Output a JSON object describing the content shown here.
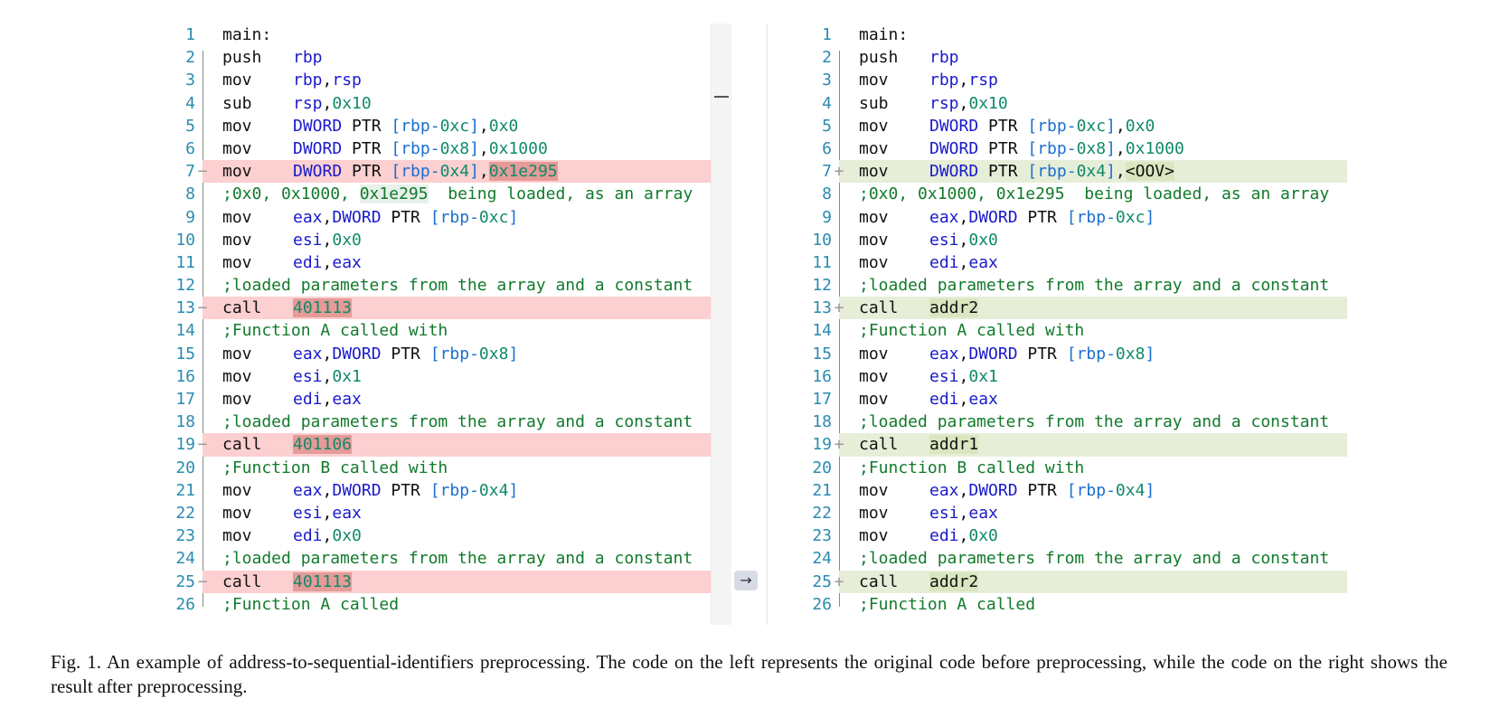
{
  "left": {
    "lines": [
      {
        "n": "1",
        "m": "",
        "bg": "",
        "code": [
          {
            "t": "main:",
            "c": "tx"
          }
        ]
      },
      {
        "n": "2",
        "m": "",
        "bg": "",
        "op": "push",
        "code": [
          {
            "t": "rbp",
            "c": "reg"
          }
        ]
      },
      {
        "n": "3",
        "m": "",
        "bg": "",
        "op": "mov",
        "code": [
          {
            "t": "rbp",
            "c": "reg"
          },
          {
            "t": ",",
            "c": "tx"
          },
          {
            "t": "rsp",
            "c": "reg"
          }
        ]
      },
      {
        "n": "4",
        "m": "",
        "bg": "",
        "op": "sub",
        "code": [
          {
            "t": "rsp",
            "c": "reg"
          },
          {
            "t": ",",
            "c": "tx"
          },
          {
            "t": "0x10",
            "c": "num"
          }
        ]
      },
      {
        "n": "5",
        "m": "",
        "bg": "",
        "op": "mov",
        "code": [
          {
            "t": "DWORD",
            "c": "kw"
          },
          {
            "t": " PTR ",
            "c": "tx"
          },
          {
            "t": "[rbp-",
            "c": "br"
          },
          {
            "t": "0xc",
            "c": "num"
          },
          {
            "t": "]",
            "c": "br"
          },
          {
            "t": ",",
            "c": "tx"
          },
          {
            "t": "0x0",
            "c": "num"
          }
        ]
      },
      {
        "n": "6",
        "m": "",
        "bg": "",
        "op": "mov",
        "code": [
          {
            "t": "DWORD",
            "c": "kw"
          },
          {
            "t": " PTR ",
            "c": "tx"
          },
          {
            "t": "[rbp-",
            "c": "br"
          },
          {
            "t": "0x8",
            "c": "num"
          },
          {
            "t": "]",
            "c": "br"
          },
          {
            "t": ",",
            "c": "tx"
          },
          {
            "t": "0x1000",
            "c": "num"
          }
        ]
      },
      {
        "n": "7",
        "m": "−",
        "bg": "del",
        "op": "mov",
        "code": [
          {
            "t": "DWORD",
            "c": "kw"
          },
          {
            "t": " PTR ",
            "c": "tx"
          },
          {
            "t": "[rbp-",
            "c": "br"
          },
          {
            "t": "0x4",
            "c": "num"
          },
          {
            "t": "]",
            "c": "br"
          },
          {
            "t": ",",
            "c": "tx"
          },
          {
            "t": "0x1e295",
            "c": "num",
            "h": "del"
          }
        ]
      },
      {
        "n": "8",
        "m": "",
        "bg": "",
        "code": [
          {
            "t": ";0x0, 0x1000, ",
            "c": "cm"
          },
          {
            "t": "0x1e295",
            "c": "cm",
            "h": "plain"
          },
          {
            "t": "  being loaded, as an array",
            "c": "cm"
          }
        ]
      },
      {
        "n": "9",
        "m": "",
        "bg": "",
        "op": "mov",
        "code": [
          {
            "t": "eax",
            "c": "reg"
          },
          {
            "t": ",",
            "c": "tx"
          },
          {
            "t": "DWORD",
            "c": "kw"
          },
          {
            "t": " PTR ",
            "c": "tx"
          },
          {
            "t": "[rbp-",
            "c": "br"
          },
          {
            "t": "0xc",
            "c": "num"
          },
          {
            "t": "]",
            "c": "br"
          }
        ]
      },
      {
        "n": "10",
        "m": "",
        "bg": "",
        "op": "mov",
        "code": [
          {
            "t": "esi",
            "c": "reg"
          },
          {
            "t": ",",
            "c": "tx"
          },
          {
            "t": "0x0",
            "c": "num"
          }
        ]
      },
      {
        "n": "11",
        "m": "",
        "bg": "",
        "op": "mov",
        "code": [
          {
            "t": "edi",
            "c": "reg"
          },
          {
            "t": ",",
            "c": "tx"
          },
          {
            "t": "eax",
            "c": "reg"
          }
        ]
      },
      {
        "n": "12",
        "m": "",
        "bg": "",
        "code": [
          {
            "t": ";loaded parameters from the array and a constant",
            "c": "cm"
          }
        ]
      },
      {
        "n": "13",
        "m": "−",
        "bg": "del",
        "op": "call",
        "code": [
          {
            "t": "401113",
            "c": "num",
            "h": "del"
          }
        ]
      },
      {
        "n": "14",
        "m": "",
        "bg": "",
        "code": [
          {
            "t": ";Function A called with",
            "c": "cm"
          }
        ]
      },
      {
        "n": "15",
        "m": "",
        "bg": "",
        "op": "mov",
        "code": [
          {
            "t": "eax",
            "c": "reg"
          },
          {
            "t": ",",
            "c": "tx"
          },
          {
            "t": "DWORD",
            "c": "kw"
          },
          {
            "t": " PTR ",
            "c": "tx"
          },
          {
            "t": "[rbp-",
            "c": "br"
          },
          {
            "t": "0x8",
            "c": "num"
          },
          {
            "t": "]",
            "c": "br"
          }
        ]
      },
      {
        "n": "16",
        "m": "",
        "bg": "",
        "op": "mov",
        "code": [
          {
            "t": "esi",
            "c": "reg"
          },
          {
            "t": ",",
            "c": "tx"
          },
          {
            "t": "0x1",
            "c": "num"
          }
        ]
      },
      {
        "n": "17",
        "m": "",
        "bg": "",
        "op": "mov",
        "code": [
          {
            "t": "edi",
            "c": "reg"
          },
          {
            "t": ",",
            "c": "tx"
          },
          {
            "t": "eax",
            "c": "reg"
          }
        ]
      },
      {
        "n": "18",
        "m": "",
        "bg": "",
        "code": [
          {
            "t": ";loaded parameters from the array and a constant",
            "c": "cm"
          }
        ]
      },
      {
        "n": "19",
        "m": "−",
        "bg": "del",
        "op": "call",
        "code": [
          {
            "t": "401106",
            "c": "num",
            "h": "del"
          }
        ]
      },
      {
        "n": "20",
        "m": "",
        "bg": "",
        "code": [
          {
            "t": ";Function B called with",
            "c": "cm"
          }
        ]
      },
      {
        "n": "21",
        "m": "",
        "bg": "",
        "op": "mov",
        "code": [
          {
            "t": "eax",
            "c": "reg"
          },
          {
            "t": ",",
            "c": "tx"
          },
          {
            "t": "DWORD",
            "c": "kw"
          },
          {
            "t": " PTR ",
            "c": "tx"
          },
          {
            "t": "[rbp-",
            "c": "br"
          },
          {
            "t": "0x4",
            "c": "num"
          },
          {
            "t": "]",
            "c": "br"
          }
        ]
      },
      {
        "n": "22",
        "m": "",
        "bg": "",
        "op": "mov",
        "code": [
          {
            "t": "esi",
            "c": "reg"
          },
          {
            "t": ",",
            "c": "tx"
          },
          {
            "t": "eax",
            "c": "reg"
          }
        ]
      },
      {
        "n": "23",
        "m": "",
        "bg": "",
        "op": "mov",
        "code": [
          {
            "t": "edi",
            "c": "reg"
          },
          {
            "t": ",",
            "c": "tx"
          },
          {
            "t": "0x0",
            "c": "num"
          }
        ]
      },
      {
        "n": "24",
        "m": "",
        "bg": "",
        "code": [
          {
            "t": ";loaded parameters from the array and a constant",
            "c": "cm"
          }
        ]
      },
      {
        "n": "25",
        "m": "−",
        "bg": "del",
        "op": "call",
        "code": [
          {
            "t": "401113",
            "c": "num",
            "h": "del"
          }
        ]
      },
      {
        "n": "26",
        "m": "",
        "bg": "",
        "code": [
          {
            "t": ";Function A called",
            "c": "cm"
          }
        ]
      }
    ]
  },
  "right": {
    "lines": [
      {
        "n": "1",
        "m": "",
        "bg": "",
        "code": [
          {
            "t": "main:",
            "c": "tx"
          }
        ]
      },
      {
        "n": "2",
        "m": "",
        "bg": "",
        "op": "push",
        "code": [
          {
            "t": "rbp",
            "c": "reg"
          }
        ]
      },
      {
        "n": "3",
        "m": "",
        "bg": "",
        "op": "mov",
        "code": [
          {
            "t": "rbp",
            "c": "reg"
          },
          {
            "t": ",",
            "c": "tx"
          },
          {
            "t": "rsp",
            "c": "reg"
          }
        ]
      },
      {
        "n": "4",
        "m": "",
        "bg": "",
        "op": "sub",
        "code": [
          {
            "t": "rsp",
            "c": "reg"
          },
          {
            "t": ",",
            "c": "tx"
          },
          {
            "t": "0x10",
            "c": "num"
          }
        ]
      },
      {
        "n": "5",
        "m": "",
        "bg": "",
        "op": "mov",
        "code": [
          {
            "t": "DWORD",
            "c": "kw"
          },
          {
            "t": " PTR ",
            "c": "tx"
          },
          {
            "t": "[rbp-",
            "c": "br"
          },
          {
            "t": "0xc",
            "c": "num"
          },
          {
            "t": "]",
            "c": "br"
          },
          {
            "t": ",",
            "c": "tx"
          },
          {
            "t": "0x0",
            "c": "num"
          }
        ]
      },
      {
        "n": "6",
        "m": "",
        "bg": "",
        "op": "mov",
        "code": [
          {
            "t": "DWORD",
            "c": "kw"
          },
          {
            "t": " PTR ",
            "c": "tx"
          },
          {
            "t": "[rbp-",
            "c": "br"
          },
          {
            "t": "0x8",
            "c": "num"
          },
          {
            "t": "]",
            "c": "br"
          },
          {
            "t": ",",
            "c": "tx"
          },
          {
            "t": "0x1000",
            "c": "num"
          }
        ]
      },
      {
        "n": "7",
        "m": "+",
        "bg": "add",
        "op": "mov",
        "code": [
          {
            "t": "DWORD",
            "c": "kw"
          },
          {
            "t": " PTR ",
            "c": "tx"
          },
          {
            "t": "[rbp-",
            "c": "br"
          },
          {
            "t": "0x4",
            "c": "num"
          },
          {
            "t": "]",
            "c": "br"
          },
          {
            "t": ",",
            "c": "tx"
          },
          {
            "t": "<OOV>",
            "c": "tx",
            "h": "add"
          }
        ]
      },
      {
        "n": "8",
        "m": "",
        "bg": "",
        "code": [
          {
            "t": ";0x0, 0x1000, 0x1e295  being loaded, as an array",
            "c": "cm"
          }
        ]
      },
      {
        "n": "9",
        "m": "",
        "bg": "",
        "op": "mov",
        "code": [
          {
            "t": "eax",
            "c": "reg"
          },
          {
            "t": ",",
            "c": "tx"
          },
          {
            "t": "DWORD",
            "c": "kw"
          },
          {
            "t": " PTR ",
            "c": "tx"
          },
          {
            "t": "[rbp-",
            "c": "br"
          },
          {
            "t": "0xc",
            "c": "num"
          },
          {
            "t": "]",
            "c": "br"
          }
        ]
      },
      {
        "n": "10",
        "m": "",
        "bg": "",
        "op": "mov",
        "code": [
          {
            "t": "esi",
            "c": "reg"
          },
          {
            "t": ",",
            "c": "tx"
          },
          {
            "t": "0x0",
            "c": "num"
          }
        ]
      },
      {
        "n": "11",
        "m": "",
        "bg": "",
        "op": "mov",
        "code": [
          {
            "t": "edi",
            "c": "reg"
          },
          {
            "t": ",",
            "c": "tx"
          },
          {
            "t": "eax",
            "c": "reg"
          }
        ]
      },
      {
        "n": "12",
        "m": "",
        "bg": "",
        "code": [
          {
            "t": ";loaded parameters from the array and a constant",
            "c": "cm"
          }
        ]
      },
      {
        "n": "13",
        "m": "+",
        "bg": "add",
        "op": "call",
        "code": [
          {
            "t": "addr2",
            "c": "tx",
            "h": "add"
          }
        ]
      },
      {
        "n": "14",
        "m": "",
        "bg": "",
        "code": [
          {
            "t": ";Function A called with",
            "c": "cm"
          }
        ]
      },
      {
        "n": "15",
        "m": "",
        "bg": "",
        "op": "mov",
        "code": [
          {
            "t": "eax",
            "c": "reg"
          },
          {
            "t": ",",
            "c": "tx"
          },
          {
            "t": "DWORD",
            "c": "kw"
          },
          {
            "t": " PTR ",
            "c": "tx"
          },
          {
            "t": "[rbp-",
            "c": "br"
          },
          {
            "t": "0x8",
            "c": "num"
          },
          {
            "t": "]",
            "c": "br"
          }
        ]
      },
      {
        "n": "16",
        "m": "",
        "bg": "",
        "op": "mov",
        "code": [
          {
            "t": "esi",
            "c": "reg"
          },
          {
            "t": ",",
            "c": "tx"
          },
          {
            "t": "0x1",
            "c": "num"
          }
        ]
      },
      {
        "n": "17",
        "m": "",
        "bg": "",
        "op": "mov",
        "code": [
          {
            "t": "edi",
            "c": "reg"
          },
          {
            "t": ",",
            "c": "tx"
          },
          {
            "t": "eax",
            "c": "reg"
          }
        ]
      },
      {
        "n": "18",
        "m": "",
        "bg": "",
        "code": [
          {
            "t": ";loaded parameters from the array and a constant",
            "c": "cm"
          }
        ]
      },
      {
        "n": "19",
        "m": "+",
        "bg": "add",
        "op": "call",
        "code": [
          {
            "t": "addr1",
            "c": "tx",
            "h": "add"
          }
        ]
      },
      {
        "n": "20",
        "m": "",
        "bg": "",
        "code": [
          {
            "t": ";Function B called with",
            "c": "cm"
          }
        ]
      },
      {
        "n": "21",
        "m": "",
        "bg": "",
        "op": "mov",
        "code": [
          {
            "t": "eax",
            "c": "reg"
          },
          {
            "t": ",",
            "c": "tx"
          },
          {
            "t": "DWORD",
            "c": "kw"
          },
          {
            "t": " PTR ",
            "c": "tx"
          },
          {
            "t": "[rbp-",
            "c": "br"
          },
          {
            "t": "0x4",
            "c": "num"
          },
          {
            "t": "]",
            "c": "br"
          }
        ]
      },
      {
        "n": "22",
        "m": "",
        "bg": "",
        "op": "mov",
        "code": [
          {
            "t": "esi",
            "c": "reg"
          },
          {
            "t": ",",
            "c": "tx"
          },
          {
            "t": "eax",
            "c": "reg"
          }
        ]
      },
      {
        "n": "23",
        "m": "",
        "bg": "",
        "op": "mov",
        "code": [
          {
            "t": "edi",
            "c": "reg"
          },
          {
            "t": ",",
            "c": "tx"
          },
          {
            "t": "0x0",
            "c": "num"
          }
        ]
      },
      {
        "n": "24",
        "m": "",
        "bg": "",
        "code": [
          {
            "t": ";loaded parameters from the array and a constant",
            "c": "cm"
          }
        ]
      },
      {
        "n": "25",
        "m": "+",
        "bg": "add",
        "op": "call",
        "code": [
          {
            "t": "addr2",
            "c": "tx",
            "h": "add"
          }
        ]
      },
      {
        "n": "26",
        "m": "",
        "bg": "",
        "code": [
          {
            "t": ";Function A called",
            "c": "cm"
          }
        ]
      }
    ]
  },
  "controls": {
    "apply_arrow_icon": "right-arrow-icon",
    "apply_arrow_glyph": "→"
  },
  "colors": {
    "deleted_line": "#fccfd0",
    "deleted_token": "#e59b98",
    "added_line": "#e6eed8",
    "added_token": "#d9e6bf"
  },
  "caption": {
    "text": "Fig. 1.  An example of address-to-sequential-identifiers preprocessing. The code on the left represents the original code before preprocessing, while the code on the right shows the result after preprocessing."
  }
}
